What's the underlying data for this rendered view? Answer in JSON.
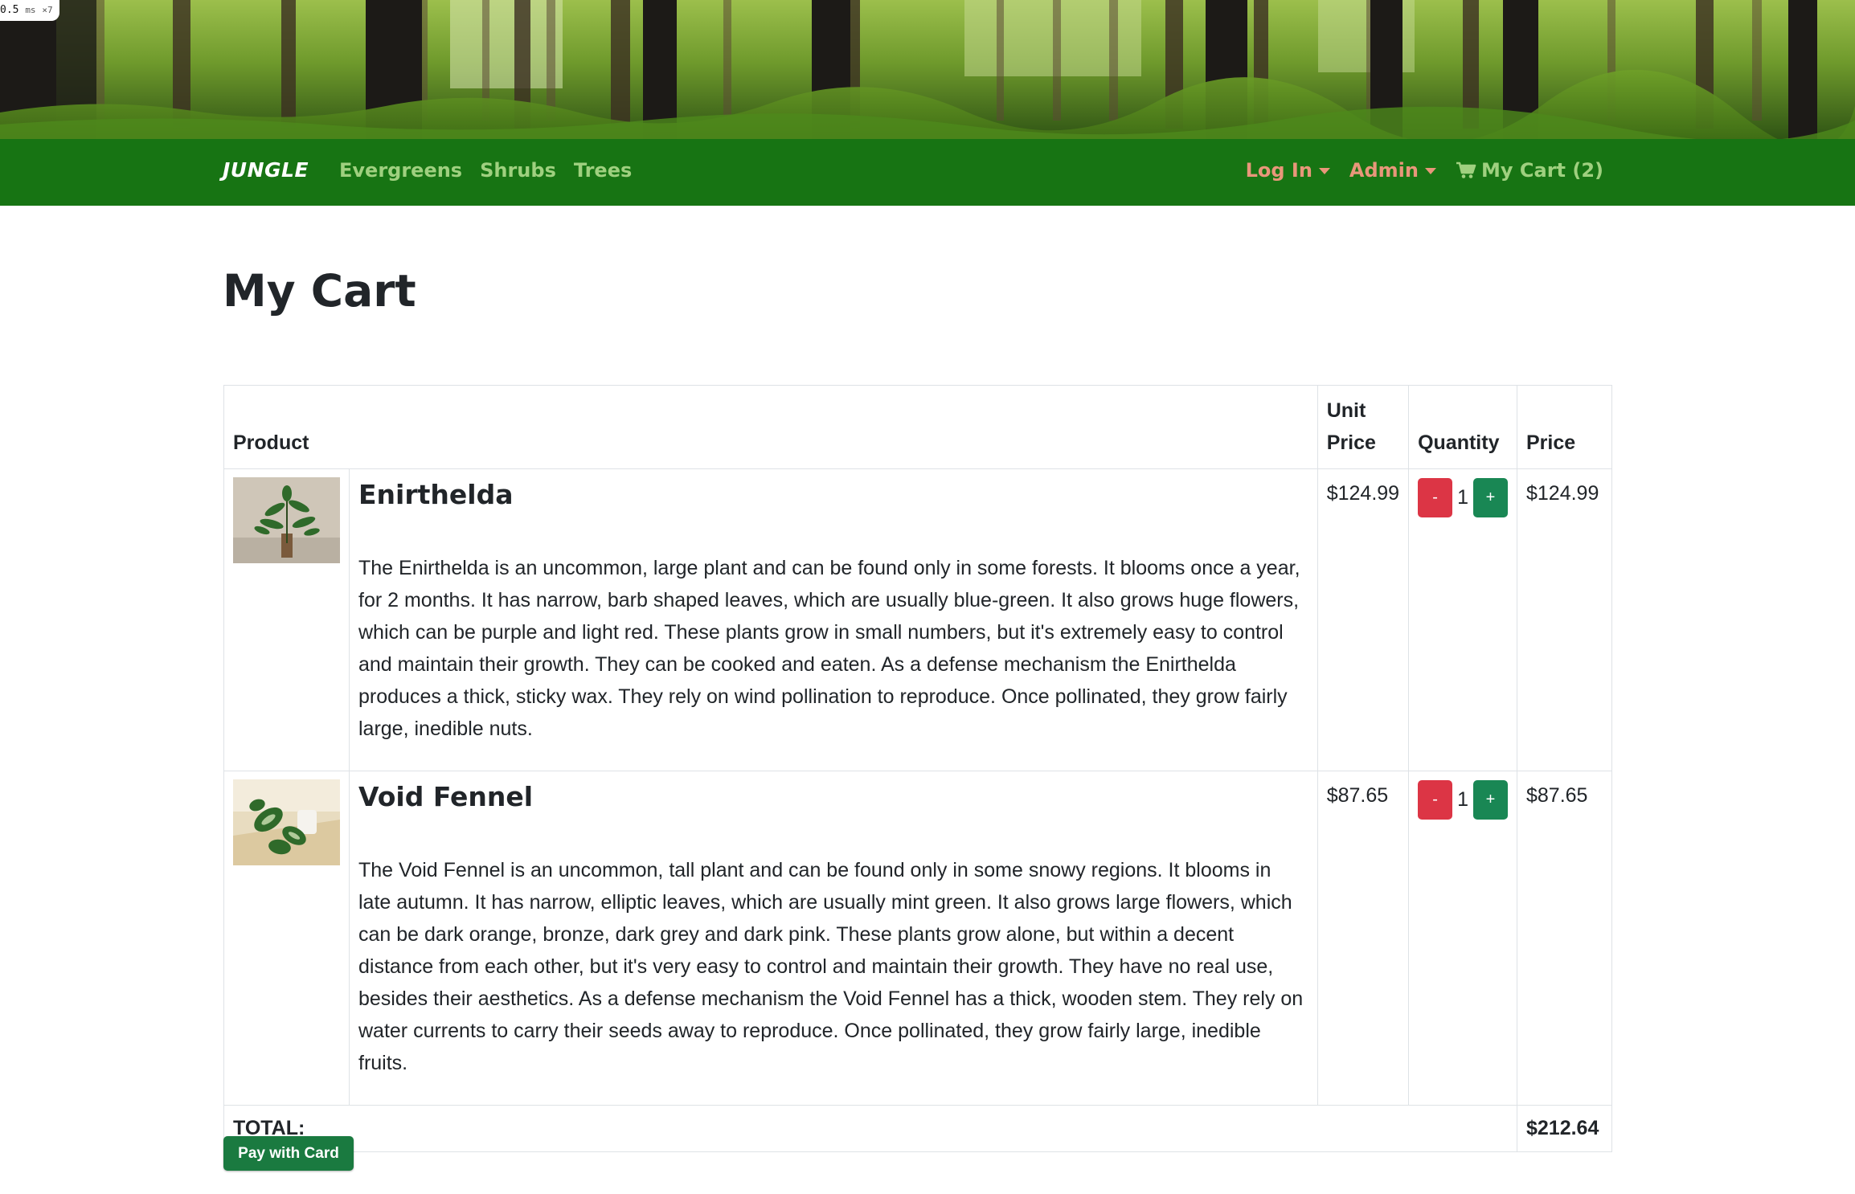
{
  "perf_badge": {
    "value": "0.5",
    "unit": "ms",
    "multiplier": "×7"
  },
  "navbar": {
    "brand": "JUNGLE",
    "links": [
      "Evergreens",
      "Shrubs",
      "Trees"
    ],
    "login_label": "Log In",
    "admin_label": "Admin",
    "cart_label": "My Cart (2)",
    "cart_icon": "cart-icon",
    "colors": {
      "background": "#177413",
      "link": "#9fd07f",
      "dropdown": "#e8977a"
    }
  },
  "page": {
    "title": "My Cart"
  },
  "table": {
    "headers": {
      "product": "Product",
      "unit_price": "Unit Price",
      "quantity": "Quantity",
      "price": "Price"
    },
    "items": [
      {
        "name": "Enirthelda",
        "description": "The Enirthelda is an uncommon, large plant and can be found only in some forests. It blooms once a year, for 2 months. It has narrow, barb shaped leaves, which are usually blue-green. It also grows huge flowers, which can be purple and light red. These plants grow in small numbers, but it's extremely easy to control and maintain their growth. They can be cooked and eaten. As a defense mechanism the Enirthelda produces a thick, sticky wax. They rely on wind pollination to reproduce. Once pollinated, they grow fairly large, inedible nuts.",
        "unit_price": "$124.99",
        "quantity": "1",
        "price": "$124.99"
      },
      {
        "name": "Void Fennel",
        "description": "The Void Fennel is an uncommon, tall plant and can be found only in some snowy regions. It blooms in late autumn. It has narrow, elliptic leaves, which are usually mint green. It also grows large flowers, which can be dark orange, bronze, dark grey and dark pink. These plants grow alone, but within a decent distance from each other, but it's very easy to control and maintain their growth. They have no real use, besides their aesthetics. As a defense mechanism the Void Fennel has a thick, wooden stem. They rely on water currents to carry their seeds away to reproduce. Once pollinated, they grow fairly large, inedible fruits.",
        "unit_price": "$87.65",
        "quantity": "1",
        "price": "$87.65"
      }
    ],
    "minus_label": "-",
    "plus_label": "+",
    "total_label": "TOTAL:",
    "total_value": "$212.64"
  },
  "pay_button": "Pay with Card"
}
